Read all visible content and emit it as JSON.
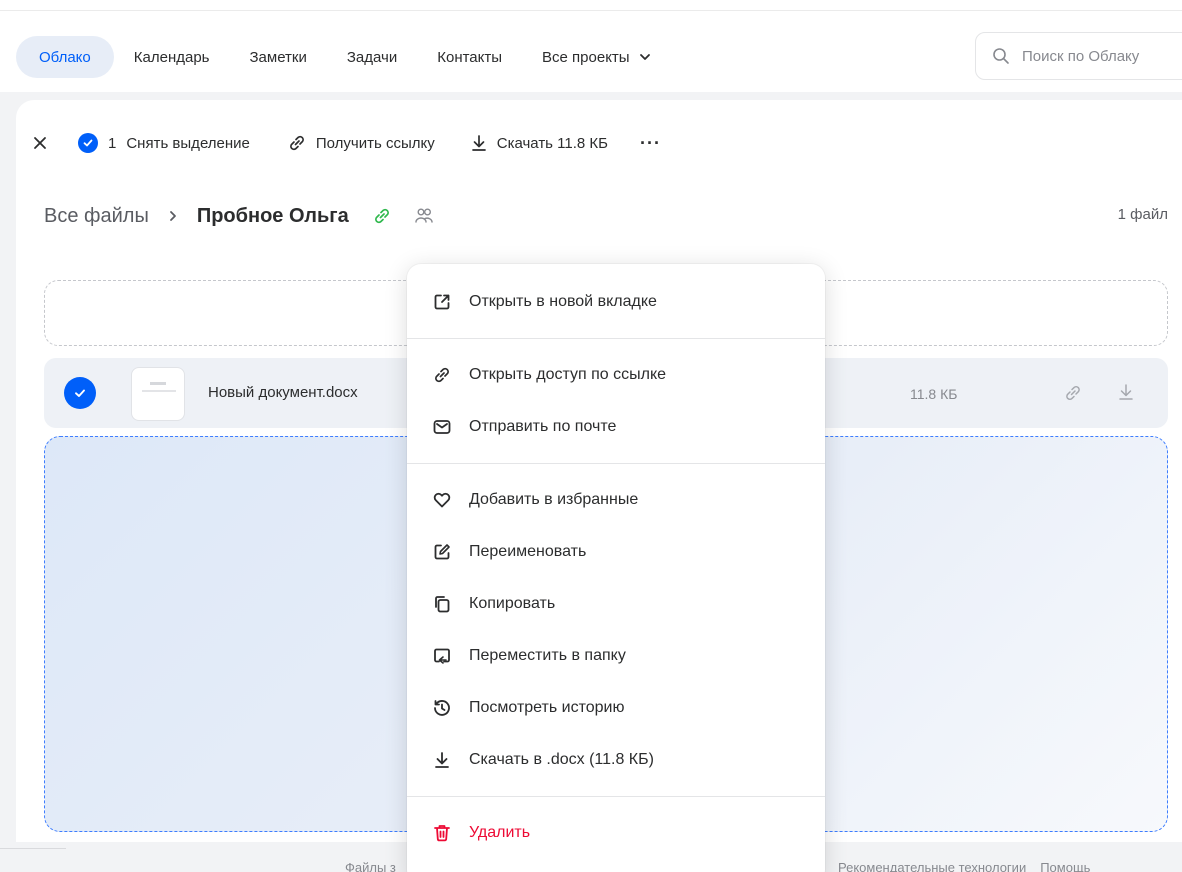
{
  "nav": {
    "items": [
      {
        "label": "Облако",
        "active": true
      },
      {
        "label": "Календарь"
      },
      {
        "label": "Заметки"
      },
      {
        "label": "Задачи"
      },
      {
        "label": "Контакты"
      },
      {
        "label": "Все проекты"
      }
    ],
    "search_placeholder": "Поиск по Облаку"
  },
  "toolbar": {
    "selected_count": "1",
    "deselect_label": "Снять выделение",
    "get_link_label": "Получить ссылку",
    "download_label": "Скачать 11.8 КБ",
    "more_label": "···"
  },
  "breadcrumbs": {
    "root": "Все файлы",
    "current": "Пробное Ольга",
    "file_count": "1 файл"
  },
  "file": {
    "name": "Новый документ.docx",
    "size": "11.8 КБ"
  },
  "context_menu": {
    "open_new_tab": "Открыть в новой вкладке",
    "share_link": "Открыть доступ по ссылке",
    "send_email": "Отправить по почте",
    "add_favorites": "Добавить в избранные",
    "rename": "Переименовать",
    "copy": "Копировать",
    "move": "Переместить в папку",
    "history": "Посмотреть историю",
    "download": "Скачать в .docx (11.8 КБ)",
    "delete": "Удалить"
  },
  "footer": {
    "left_text": "Файлы з",
    "recommend": "Рекомендательные технологии",
    "help": "Помощь"
  },
  "colors": {
    "accent": "#005ff9",
    "green_link": "#2fb84d",
    "danger": "#ed0a34"
  }
}
